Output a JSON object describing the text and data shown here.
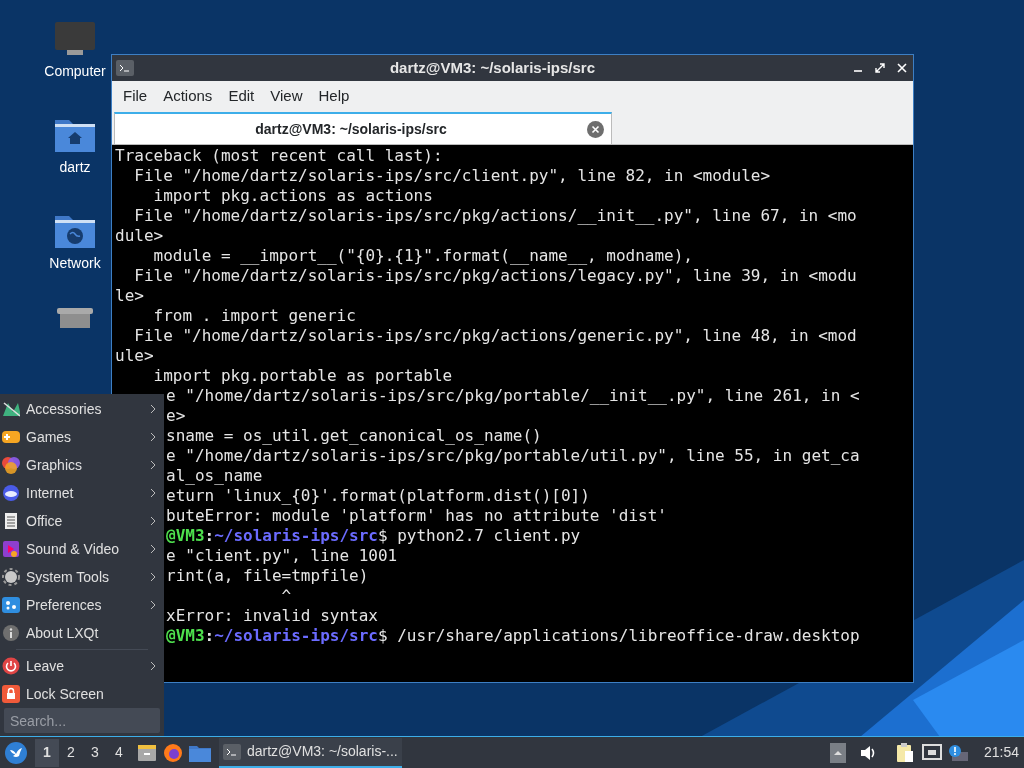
{
  "desktop_icons": [
    {
      "kind": "computer",
      "label": "Computer"
    },
    {
      "kind": "home",
      "label": "dartz"
    },
    {
      "kind": "network",
      "label": "Network"
    },
    {
      "kind": "trash"
    }
  ],
  "window": {
    "title": "dartz@VM3: ~/solaris-ips/src",
    "menu": [
      "File",
      "Actions",
      "Edit",
      "View",
      "Help"
    ],
    "tabs": [
      {
        "label": "dartz@VM3: ~/solaris-ips/src",
        "selected": true
      }
    ],
    "terminal_lines": [
      {
        "text": "Traceback (most recent call last):"
      },
      {
        "text": "  File \"/home/dartz/solaris-ips/src/client.py\", line 82, in <module>"
      },
      {
        "text": "    import pkg.actions as actions"
      },
      {
        "text": "  File \"/home/dartz/solaris-ips/src/pkg/actions/__init__.py\", line 67, in <mo"
      },
      {
        "text": "dule>"
      },
      {
        "text": "    module = __import__(\"{0}.{1}\".format(__name__, modname),"
      },
      {
        "text": "  File \"/home/dartz/solaris-ips/src/pkg/actions/legacy.py\", line 39, in <modu"
      },
      {
        "text": "le>"
      },
      {
        "text": "    from . import generic"
      },
      {
        "text": "  File \"/home/dartz/solaris-ips/src/pkg/actions/generic.py\", line 48, in <mod"
      },
      {
        "text": "ule>"
      },
      {
        "text": "    import pkg.portable as portable"
      },
      {
        "text": "e \"/home/dartz/solaris-ips/src/pkg/portable/__init__.py\", line 261, in <",
        "cut": true
      },
      {
        "text": "e>",
        "cut": true
      },
      {
        "text": "sname = os_util.get_canonical_os_name()",
        "cut": true
      },
      {
        "text": "e \"/home/dartz/solaris-ips/src/pkg/portable/util.py\", line 55, in get_ca",
        "cut": true
      },
      {
        "text": "al_os_name",
        "cut": true
      },
      {
        "text": "eturn 'linux_{0}'.format(platform.dist()[0])",
        "cut": true
      },
      {
        "text": "buteError: module 'platform' has no attribute 'dist'",
        "cut": true
      },
      {
        "kind": "prompt",
        "host": "@VM3",
        "sep": ":",
        "path": "~/solaris-ips/src",
        "command": "$ python2.7 client.py",
        "cut": true
      },
      {
        "text": "e \"client.py\", line 1001",
        "cut": true
      },
      {
        "text": "rint(a, file=tmpfile)",
        "cut": true
      },
      {
        "text": "            ^",
        "cut": true
      },
      {
        "text": "xError: invalid syntax",
        "cut": true
      },
      {
        "kind": "prompt",
        "host": "@VM3",
        "sep": ":",
        "path": "~/solaris-ips/src",
        "command": "$ /usr/share/applications/libreoffice-draw.desktop",
        "cut": true
      }
    ]
  },
  "app_menu": {
    "items": [
      {
        "kind": "accessories",
        "label": "Accessories",
        "submenu": true
      },
      {
        "kind": "games",
        "label": "Games",
        "submenu": true
      },
      {
        "kind": "graphics",
        "label": "Graphics",
        "submenu": true
      },
      {
        "kind": "internet",
        "label": "Internet",
        "submenu": true
      },
      {
        "kind": "office",
        "label": "Office",
        "submenu": true
      },
      {
        "kind": "sound",
        "label": "Sound & Video",
        "submenu": true
      },
      {
        "kind": "system",
        "label": "System Tools",
        "submenu": true
      },
      {
        "kind": "preferences",
        "label": "Preferences",
        "submenu": true
      },
      {
        "kind": "about",
        "label": "About LXQt",
        "submenu": false
      },
      {
        "kind": "leave",
        "label": "Leave",
        "submenu": true
      },
      {
        "kind": "lock",
        "label": "Lock Screen",
        "submenu": false
      }
    ],
    "search": {
      "placeholder": "Search..."
    }
  },
  "taskbar": {
    "desktops": [
      {
        "label": "1",
        "selected": true
      },
      {
        "label": "2",
        "selected": false
      },
      {
        "label": "3",
        "selected": false
      },
      {
        "label": "4",
        "selected": false
      }
    ],
    "tasks": [
      {
        "label": "dartz@VM3: ~/solaris-...",
        "selected": true
      }
    ],
    "clock": "21:54"
  }
}
